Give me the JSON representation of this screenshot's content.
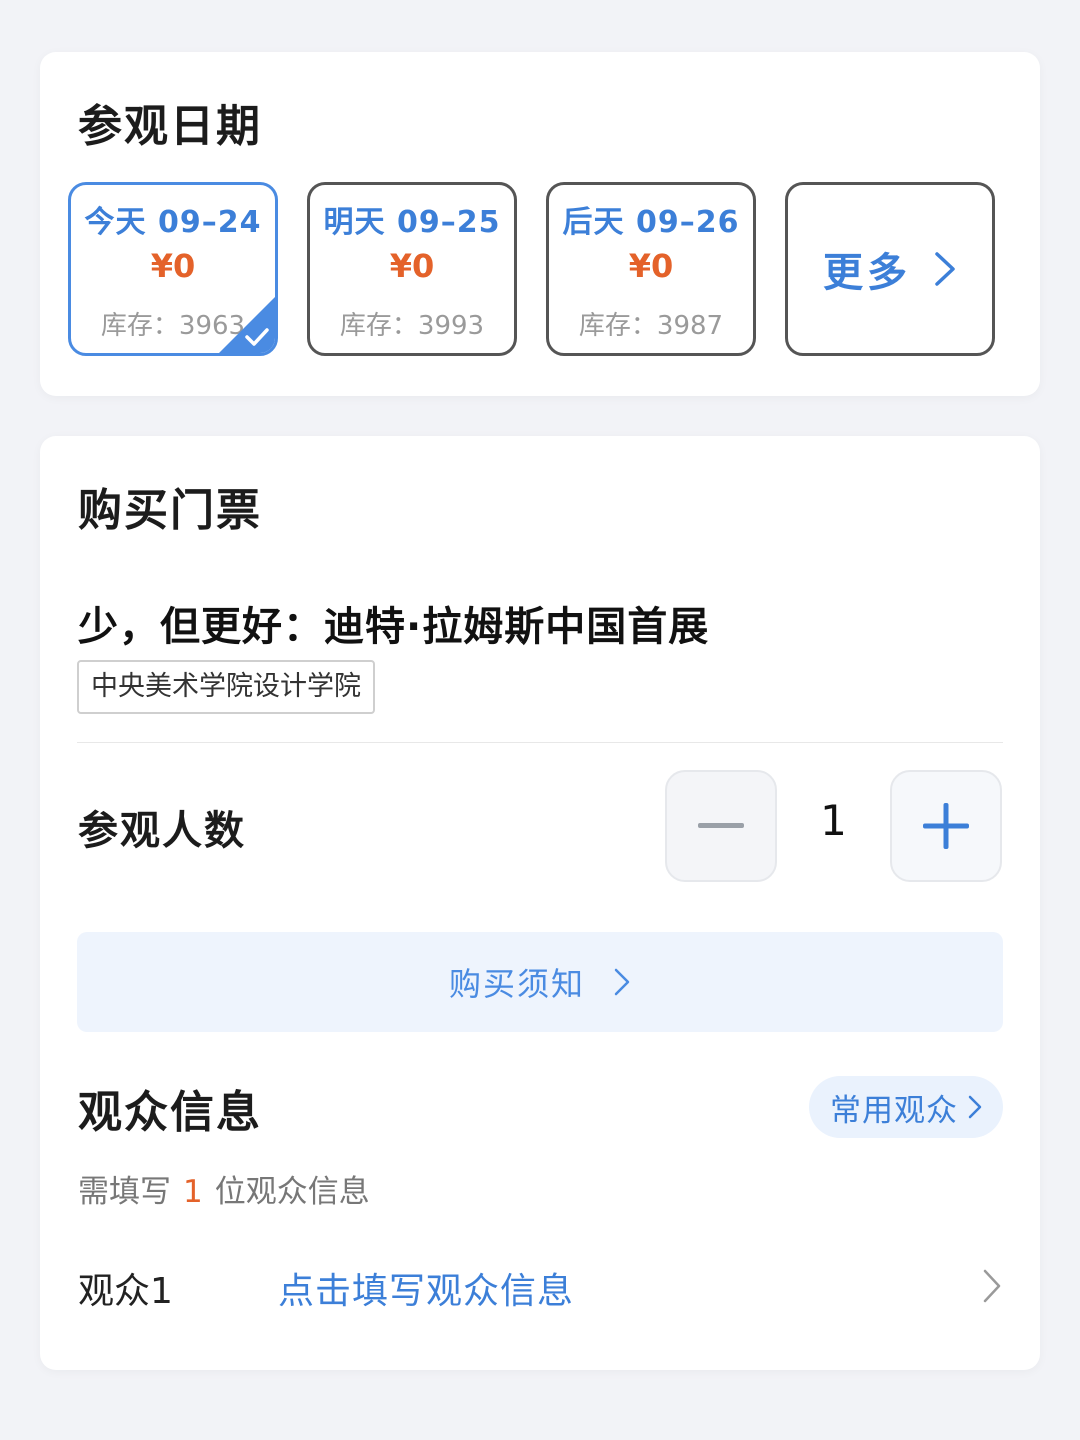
{
  "date_section": {
    "title": "参观日期",
    "options": [
      {
        "label": "今天 09–24",
        "price": "¥0",
        "stock": "库存：3963",
        "selected": true
      },
      {
        "label": "明天 09–25",
        "price": "¥0",
        "stock": "库存：3993",
        "selected": false
      },
      {
        "label": "后天 09–26",
        "price": "¥0",
        "stock": "库存：3987",
        "selected": false
      }
    ],
    "more_label": "更多"
  },
  "ticket_section": {
    "title": "购买门票",
    "exhibition_title": "少，但更好：迪特·拉姆斯中国首展",
    "organizer_tag": "中央美术学院设计学院",
    "visitor_count_label": "参观人数",
    "visitor_count": "1",
    "purchase_notice": "购买须知"
  },
  "audience_section": {
    "title": "观众信息",
    "common_audience_button": "常用观众",
    "hint_prefix": "需填写",
    "hint_count": "1",
    "hint_suffix": "位观众信息",
    "rows": [
      {
        "name": "观众1",
        "action": "点击填写观众信息"
      }
    ]
  },
  "colors": {
    "accent_blue": "#3c7fd8",
    "price_orange": "#e4622a",
    "selected_border": "#4a8be2",
    "page_background": "#f2f3f7"
  }
}
